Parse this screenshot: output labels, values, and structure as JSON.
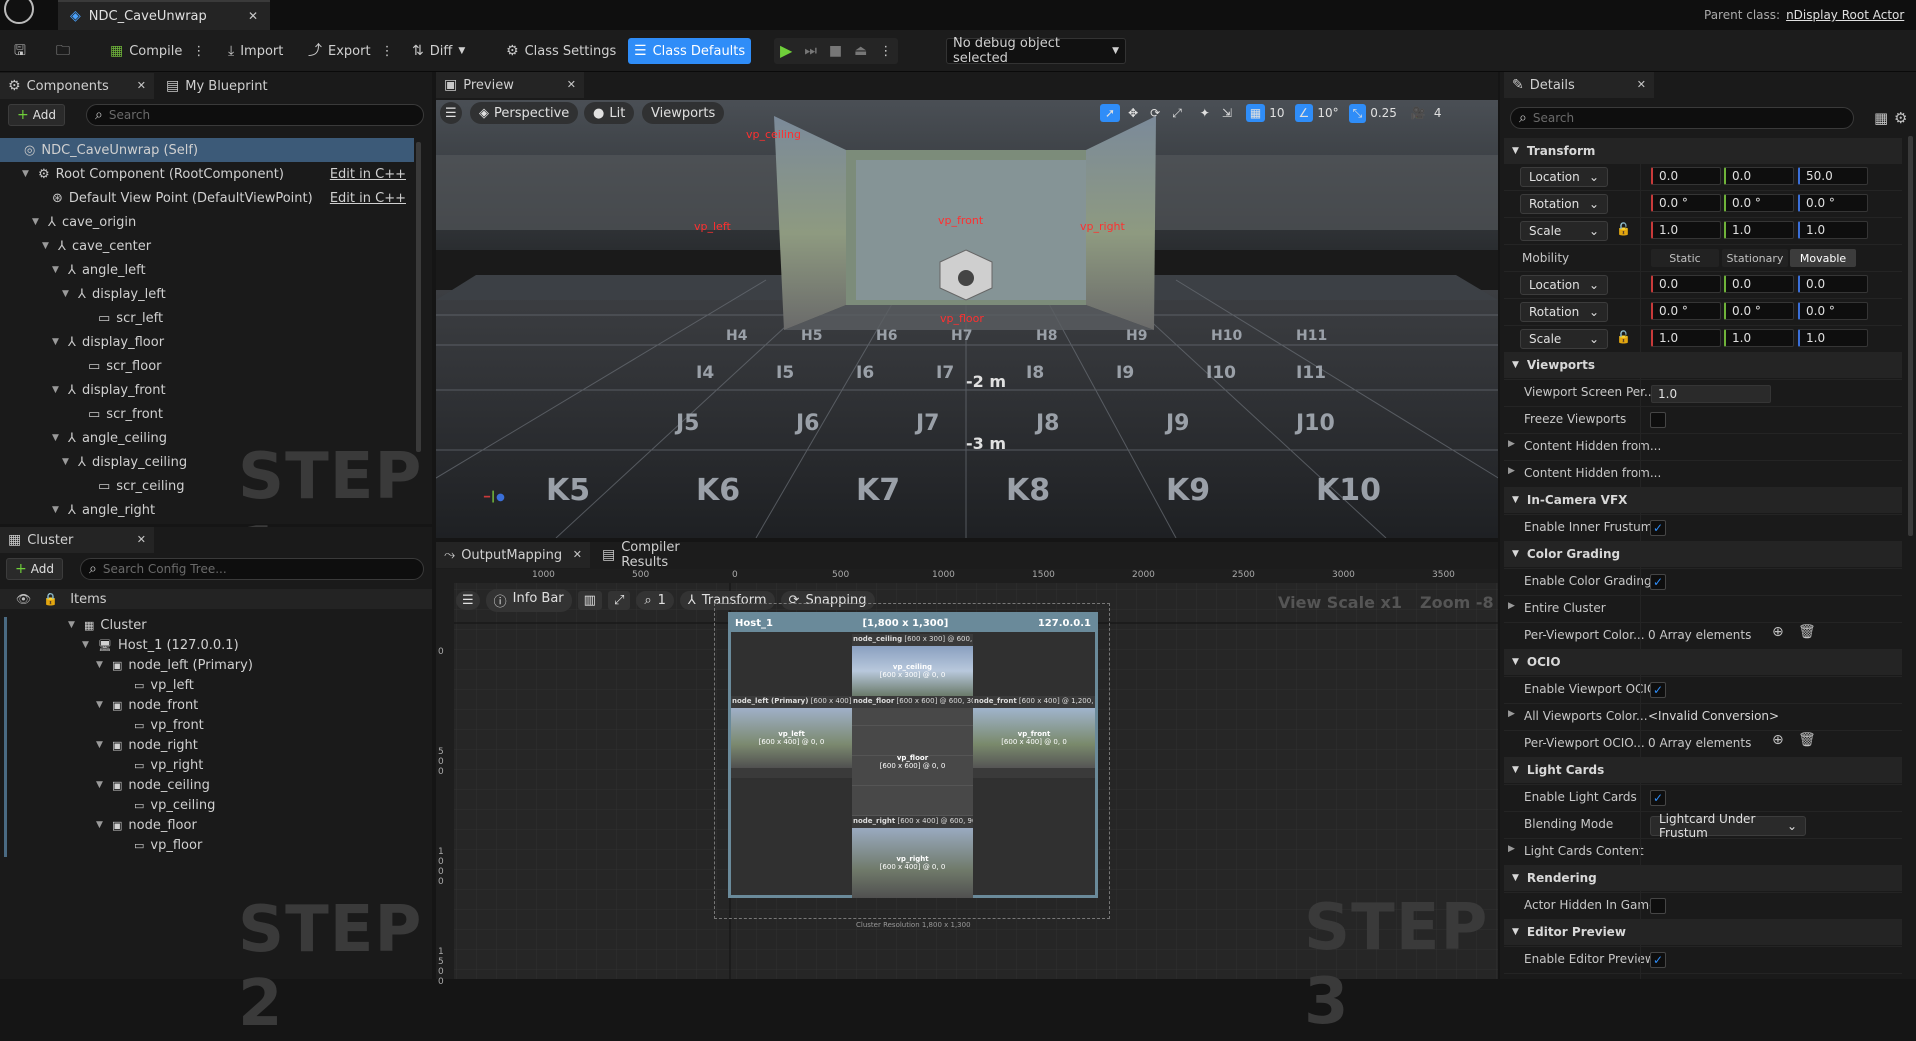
{
  "window": {
    "doc_tab": "NDC_CaveUnwrap",
    "parent_class_label": "Parent class:",
    "parent_class": "nDisplay Root Actor"
  },
  "toolbar": {
    "compile": "Compile",
    "import": "Import",
    "export": "Export",
    "diff": "Diff",
    "class_settings": "Class Settings",
    "class_defaults": "Class Defaults",
    "debug": "No debug object selected"
  },
  "components": {
    "tab": "Components",
    "tab2": "My Blueprint",
    "add": "Add",
    "search_placeholder": "Search",
    "items": [
      {
        "label": "NDC_CaveUnwrap (Self)",
        "indent": 8,
        "tri": "",
        "icon": "◎",
        "sel": true
      },
      {
        "label": "Root Component (RootComponent)",
        "indent": 22,
        "tri": "▼",
        "icon": "⚙",
        "cpp": "Edit in C++"
      },
      {
        "label": "Default View Point (DefaultViewPoint)",
        "indent": 36,
        "tri": "",
        "icon": "⊛",
        "cpp": "Edit in C++"
      },
      {
        "label": "cave_origin",
        "indent": 32,
        "tri": "▼",
        "icon": "⅄"
      },
      {
        "label": "cave_center",
        "indent": 42,
        "tri": "▼",
        "icon": "⅄"
      },
      {
        "label": "angle_left",
        "indent": 52,
        "tri": "▼",
        "icon": "⅄"
      },
      {
        "label": "display_left",
        "indent": 62,
        "tri": "▼",
        "icon": "⅄"
      },
      {
        "label": "scr_left",
        "indent": 82,
        "tri": "",
        "icon": "▭"
      },
      {
        "label": "display_floor",
        "indent": 52,
        "tri": "▼",
        "icon": "⅄"
      },
      {
        "label": "scr_floor",
        "indent": 72,
        "tri": "",
        "icon": "▭"
      },
      {
        "label": "display_front",
        "indent": 52,
        "tri": "▼",
        "icon": "⅄"
      },
      {
        "label": "scr_front",
        "indent": 72,
        "tri": "",
        "icon": "▭"
      },
      {
        "label": "angle_ceiling",
        "indent": 52,
        "tri": "▼",
        "icon": "⅄"
      },
      {
        "label": "display_ceiling",
        "indent": 62,
        "tri": "▼",
        "icon": "⅄"
      },
      {
        "label": "scr_ceiling",
        "indent": 82,
        "tri": "",
        "icon": "▭"
      },
      {
        "label": "angle_right",
        "indent": 52,
        "tri": "▼",
        "icon": "⅄"
      }
    ]
  },
  "cluster": {
    "tab": "Cluster",
    "add": "Add",
    "search_placeholder": "Search Config Tree...",
    "header": "Items",
    "items": [
      {
        "label": "Cluster",
        "indent": 68,
        "icon": "▦"
      },
      {
        "label": "Host_1 (127.0.0.1)",
        "indent": 82,
        "icon": "🖥"
      },
      {
        "label": "node_left (Primary)",
        "indent": 96,
        "icon": "▣"
      },
      {
        "label": "vp_left",
        "indent": 118,
        "icon": "▭"
      },
      {
        "label": "node_front",
        "indent": 96,
        "icon": "▣"
      },
      {
        "label": "vp_front",
        "indent": 118,
        "icon": "▭"
      },
      {
        "label": "node_right",
        "indent": 96,
        "icon": "▣"
      },
      {
        "label": "vp_right",
        "indent": 118,
        "icon": "▭"
      },
      {
        "label": "node_ceiling",
        "indent": 96,
        "icon": "▣"
      },
      {
        "label": "vp_ceiling",
        "indent": 118,
        "icon": "▭"
      },
      {
        "label": "node_floor",
        "indent": 96,
        "icon": "▣"
      },
      {
        "label": "vp_floor",
        "indent": 118,
        "icon": "▭"
      }
    ]
  },
  "steps": {
    "s1": "STEP 1",
    "s2": "STEP 2",
    "s3": "STEP 3"
  },
  "preview": {
    "tab": "Preview",
    "perspective": "Perspective",
    "lit": "Lit",
    "viewports": "Viewports",
    "grid": "10",
    "angle": "10°",
    "scale": "0.25",
    "cam": "4",
    "labels": {
      "ceiling": "vp_ceiling",
      "left": "vp_left",
      "front": "vp_front",
      "right": "vp_right",
      "floor": "vp_floor"
    },
    "floor_labels": [
      "H4",
      "H5",
      "H6",
      "H7",
      "H8",
      "H9",
      "H10",
      "H11",
      "I4",
      "I5",
      "I6",
      "I7",
      "I8",
      "I9",
      "I10",
      "I11",
      "J5",
      "J6",
      "J7",
      "J8",
      "J9",
      "J10",
      "K5",
      "K6",
      "K7",
      "K8",
      "K9",
      "K10"
    ],
    "dist": [
      "-2 m",
      "-3 m"
    ]
  },
  "output": {
    "tab": "OutputMapping",
    "tab2": "Compiler Results",
    "info_bar": "Info Bar",
    "zoom_num": "1",
    "transform": "Transform",
    "snapping": "Snapping",
    "view_scale": "View Scale x1",
    "zoom": "Zoom -8",
    "ruler": [
      "1000",
      "500",
      "0",
      "500",
      "1000",
      "1500",
      "2000",
      "2500",
      "3000",
      "3500"
    ],
    "vruler": [
      "0",
      "500",
      "1000",
      "1500"
    ],
    "host": "Host_1",
    "host_res": "[1,800 x 1,300]",
    "host_ip": "127.0.0.1",
    "node_ceiling": "node_ceiling",
    "node_ceiling_info": "[600 x 300] @ 600, 0",
    "vp_ceiling": "vp_ceiling",
    "vp_ceiling_info": "[600 x 300] @ 0, 0",
    "node_left": "node_left (Primary)",
    "node_left_info": "[600 x 400] @ 0, 300",
    "vp_left": "vp_left",
    "vp_left_info": "[600 x 400] @ 0, 0",
    "node_floor": "node_floor",
    "node_floor_info": "[600 x 600] @ 600, 300",
    "vp_floor": "vp_floor",
    "vp_floor_info": "[600 x 600] @ 0, 0",
    "node_front": "node_front",
    "node_front_info": "[600 x 400] @ 1,200, 300",
    "vp_front": "vp_front",
    "vp_front_info": "[600 x 400] @ 0, 0",
    "node_right": "node_right",
    "node_right_info": "[600 x 400] @ 600, 900",
    "vp_right": "vp_right",
    "vp_right_info": "[600 x 400] @ 0, 0",
    "cluster_res": "Cluster Resolution 1,800 x 1,300"
  },
  "details": {
    "tab": "Details",
    "search_placeholder": "Search",
    "transform": "Transform",
    "location": "Location",
    "rotation": "Rotation",
    "scale": "Scale",
    "mobility": "Mobility",
    "loc1": [
      "0.0",
      "0.0",
      "50.0"
    ],
    "rot1": [
      "0.0 °",
      "0.0 °",
      "0.0 °"
    ],
    "scale1": [
      "1.0",
      "1.0",
      "1.0"
    ],
    "mob": [
      "Static",
      "Stationary",
      "Movable"
    ],
    "loc2": [
      "0.0",
      "0.0",
      "0.0"
    ],
    "rot2": [
      "0.0 °",
      "0.0 °",
      "0.0 °"
    ],
    "scale2": [
      "1.0",
      "1.0",
      "1.0"
    ],
    "viewports": "Viewports",
    "vsp": "Viewport Screen Per...",
    "vsp_val": "1.0",
    "freeze": "Freeze Viewports",
    "chf1": "Content Hidden from...",
    "chf2": "Content Hidden from...",
    "icvfx": "In-Camera VFX",
    "inner_frustum": "Enable Inner Frustum",
    "color_grading": "Color Grading",
    "enable_cg": "Enable Color Grading",
    "entire_cluster": "Entire Cluster",
    "pvc": "Per-Viewport Color...",
    "array0": "0 Array elements",
    "ocio": "OCIO",
    "enable_ocio": "Enable Viewport OCIO",
    "all_vp": "All Viewports Color...",
    "invalid": "<Invalid Conversion>",
    "pv_ocio": "Per-Viewport OCIO...",
    "array1": "0 Array elements",
    "light_cards": "Light Cards",
    "enable_lc": "Enable Light Cards",
    "blending": "Blending Mode",
    "blending_val": "Lightcard Under Frustum",
    "lc_content": "Light Cards Content",
    "rendering": "Rendering",
    "hidden_game": "Actor Hidden In Game",
    "editor_preview": "Editor Preview",
    "enable_preview": "Enable Editor Preview"
  },
  "colors": {
    "accent": "#2f8df8",
    "x": "#c83a3a",
    "y": "#6fb33a",
    "z": "#3a6fd8"
  }
}
